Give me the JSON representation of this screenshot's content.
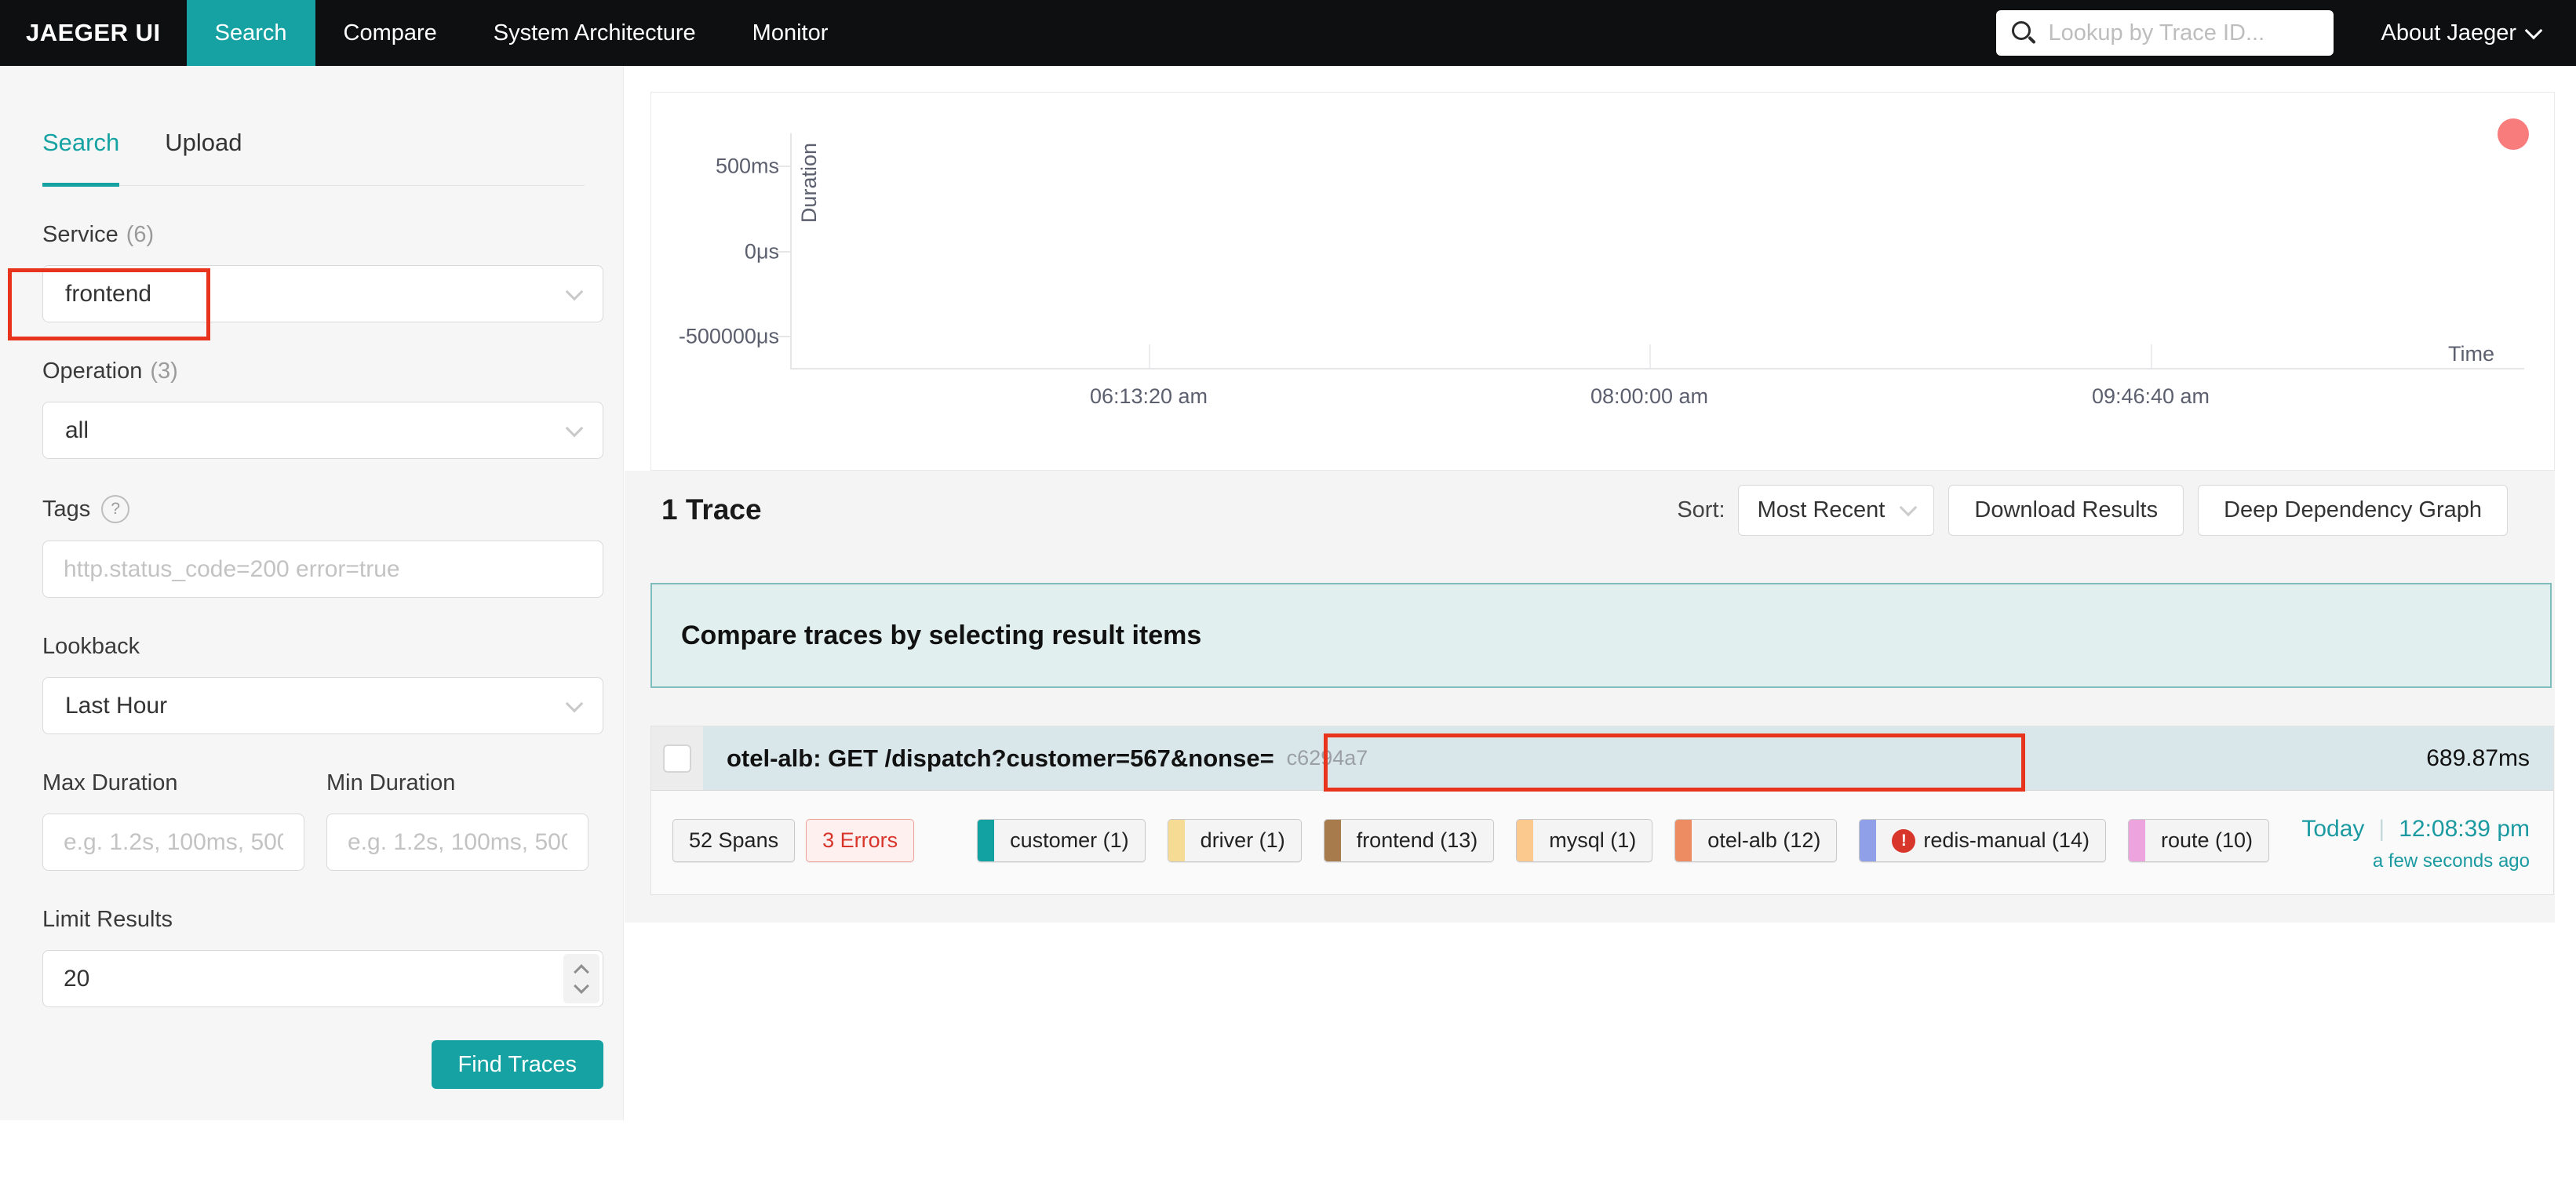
{
  "nav": {
    "brand": "JAEGER UI",
    "items": [
      {
        "label": "Search",
        "active": true
      },
      {
        "label": "Compare",
        "active": false
      },
      {
        "label": "System Architecture",
        "active": false
      },
      {
        "label": "Monitor",
        "active": false
      }
    ],
    "trace_lookup_placeholder": "Lookup by Trace ID...",
    "about_label": "About Jaeger"
  },
  "sidebar": {
    "tabs": [
      {
        "label": "Search",
        "active": true
      },
      {
        "label": "Upload",
        "active": false
      }
    ],
    "service": {
      "label": "Service",
      "count": "(6)",
      "value": "frontend"
    },
    "operation": {
      "label": "Operation",
      "count": "(3)",
      "value": "all"
    },
    "tags": {
      "label": "Tags",
      "help_glyph": "?",
      "placeholder": "http.status_code=200 error=true"
    },
    "lookback": {
      "label": "Lookback",
      "value": "Last Hour"
    },
    "max_duration": {
      "label": "Max Duration",
      "placeholder": "e.g. 1.2s, 100ms, 500..."
    },
    "min_duration": {
      "label": "Min Duration",
      "placeholder": "e.g. 1.2s, 100ms, 500..."
    },
    "limit": {
      "label": "Limit Results",
      "value": "20"
    },
    "find_traces_label": "Find Traces"
  },
  "chart_data": {
    "type": "scatter",
    "title": "",
    "xlabel": "Time",
    "ylabel": "Duration",
    "x_ticks": [
      "06:13:20 am",
      "08:00:00 am",
      "09:46:40 am"
    ],
    "y_ticks": [
      "500ms",
      "0μs",
      "-500000μs"
    ],
    "ylim_label": [
      "-500000μs",
      "500ms"
    ],
    "grid": false,
    "points": [
      {
        "x_time": "12:08:39 pm",
        "duration_ms": 689.87,
        "color": "#f87c7c"
      }
    ]
  },
  "results": {
    "count_label": "1 Trace",
    "sort": {
      "label": "Sort:",
      "value": "Most Recent"
    },
    "download_label": "Download Results",
    "deep_dependency_label": "Deep Dependency Graph",
    "banner_text": "Compare traces by selecting result items",
    "trace": {
      "title": "otel-alb: GET /dispatch?customer=567&nonse=",
      "trace_id": "c6294a7",
      "duration": "689.87ms",
      "spans_label": "52 Spans",
      "errors_label": "3 Errors",
      "error_glyph": "!",
      "services": [
        {
          "label": "customer (1)",
          "color": "#12a2a2"
        },
        {
          "label": "driver (1)",
          "color": "#f6db94"
        },
        {
          "label": "frontend (13)",
          "color": "#a87b4d"
        },
        {
          "label": "mysql (1)",
          "color": "#fbc98e"
        },
        {
          "label": "otel-alb (12)",
          "color": "#ed8c63"
        },
        {
          "label": "redis-manual (14)",
          "color": "#8f9fe8",
          "has_error": true
        },
        {
          "label": "route (10)",
          "color": "#eda3de"
        }
      ],
      "date": "Today",
      "time": "12:08:39 pm",
      "relative_time": "a few seconds ago"
    }
  },
  "annotations": {
    "highlight_color": "#e8341c"
  }
}
